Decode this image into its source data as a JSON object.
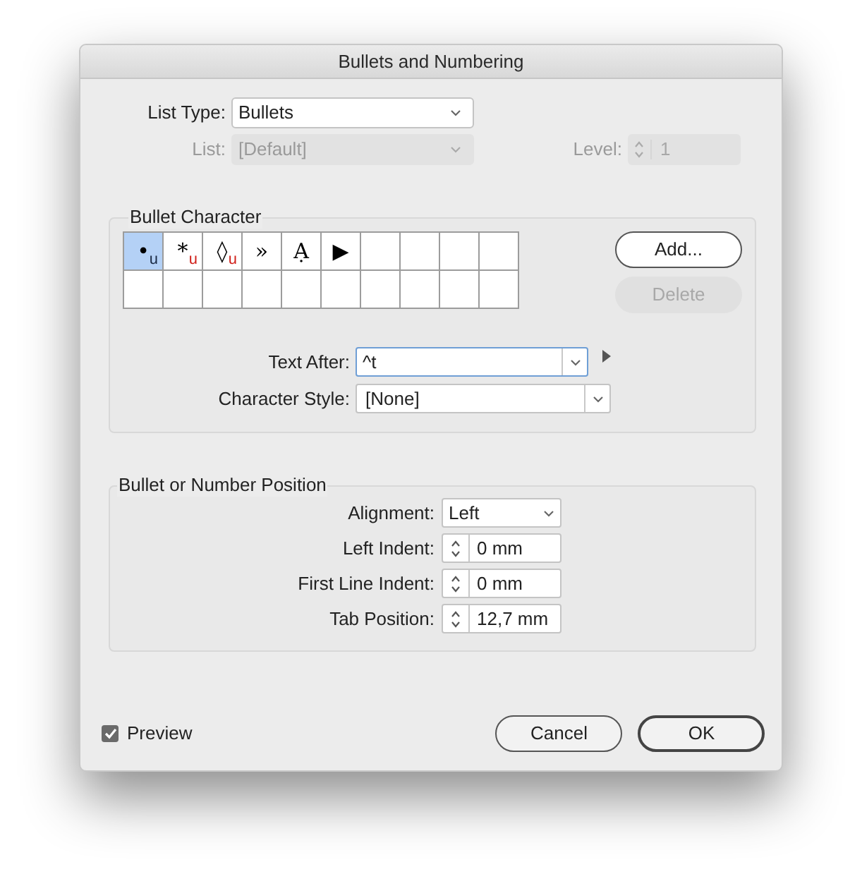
{
  "window": {
    "title": "Bullets and Numbering"
  },
  "list_type": {
    "label": "List Type:",
    "value": "Bullets",
    "disabled": false
  },
  "list": {
    "label": "List:",
    "value": "[Default]",
    "disabled": true
  },
  "level": {
    "label": "Level:",
    "value": "1",
    "disabled": true
  },
  "bullet_character": {
    "title": "Bullet Character",
    "glyphs": [
      {
        "glyph": "•",
        "mark": "u",
        "selected": true,
        "kind": "text"
      },
      {
        "glyph": "*",
        "mark": "u",
        "selected": false,
        "kind": "text"
      },
      {
        "glyph": "◊",
        "mark": "u",
        "selected": false,
        "kind": "text"
      },
      {
        "glyph": "»",
        "selected": false,
        "kind": "text"
      },
      {
        "glyph": "Ạ",
        "selected": false,
        "kind": "text"
      },
      {
        "glyph": "▶",
        "selected": false,
        "kind": "text"
      }
    ],
    "buttons": [
      {
        "label": "Add...",
        "disabled": false
      },
      {
        "label": "Delete",
        "disabled": true
      }
    ],
    "text_after": {
      "label": "Text After:",
      "value": "^t"
    },
    "character_style": {
      "label": "Character Style:",
      "value": "[None]"
    }
  },
  "position": {
    "title": "Bullet or Number Position",
    "fields": [
      {
        "kind": "select",
        "label": "Alignment:",
        "value": "Left"
      },
      {
        "kind": "stepper",
        "label": "Left Indent:",
        "value": "0 mm"
      },
      {
        "kind": "stepper",
        "label": "First Line Indent:",
        "value": "0 mm"
      },
      {
        "kind": "stepper",
        "label": "Tab Position:",
        "value": "12,7 mm"
      }
    ]
  },
  "preview": {
    "label": "Preview",
    "checked": true
  },
  "buttons": [
    {
      "label": "Cancel",
      "kind": "secondary"
    },
    {
      "label": "OK",
      "kind": "default"
    }
  ]
}
